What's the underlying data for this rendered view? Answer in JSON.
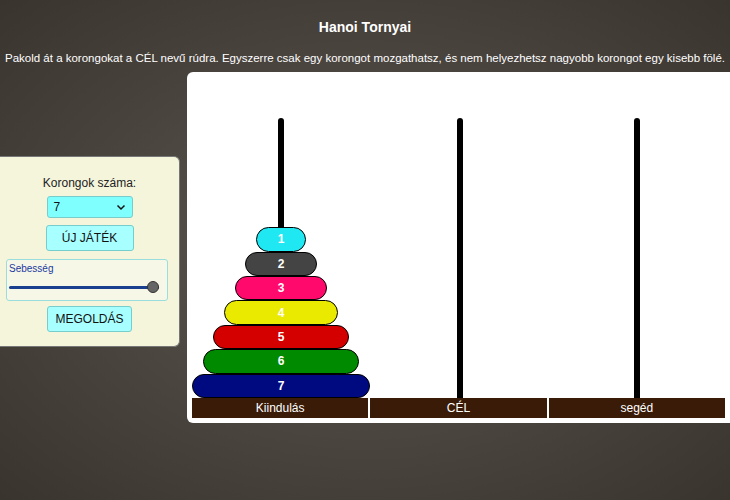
{
  "window": {
    "title": "Hanoi Tornyai"
  },
  "instruction": "Pakold át a korongokat a CÉL nevű rúdra. Egyszerre csak egy korongot mozgathatsz, és nem helyezhetsz nagyobb korongot egy kisebb fölé.",
  "controls": {
    "disk_count_label": "Korongok száma:",
    "disk_count_value": "7",
    "new_game_button": "ÚJ JÁTÉK",
    "speed": {
      "label": "Sebesség",
      "level": 0.96
    },
    "solve_button": "MEGOLDÁS"
  },
  "rods": [
    {
      "label": "Kiindulás",
      "disks": [
        {
          "label": "1",
          "color": "#1fe8f2"
        },
        {
          "label": "2",
          "color": "#444444"
        },
        {
          "label": "3",
          "color": "#ff0a6c"
        },
        {
          "label": "4",
          "color": "#eaea00"
        },
        {
          "label": "5",
          "color": "#d40000"
        },
        {
          "label": "6",
          "color": "#008a00"
        },
        {
          "label": "7",
          "color": "#000a80"
        }
      ]
    },
    {
      "label": "CÉL",
      "disks": []
    },
    {
      "label": "segéd",
      "disks": []
    }
  ]
}
